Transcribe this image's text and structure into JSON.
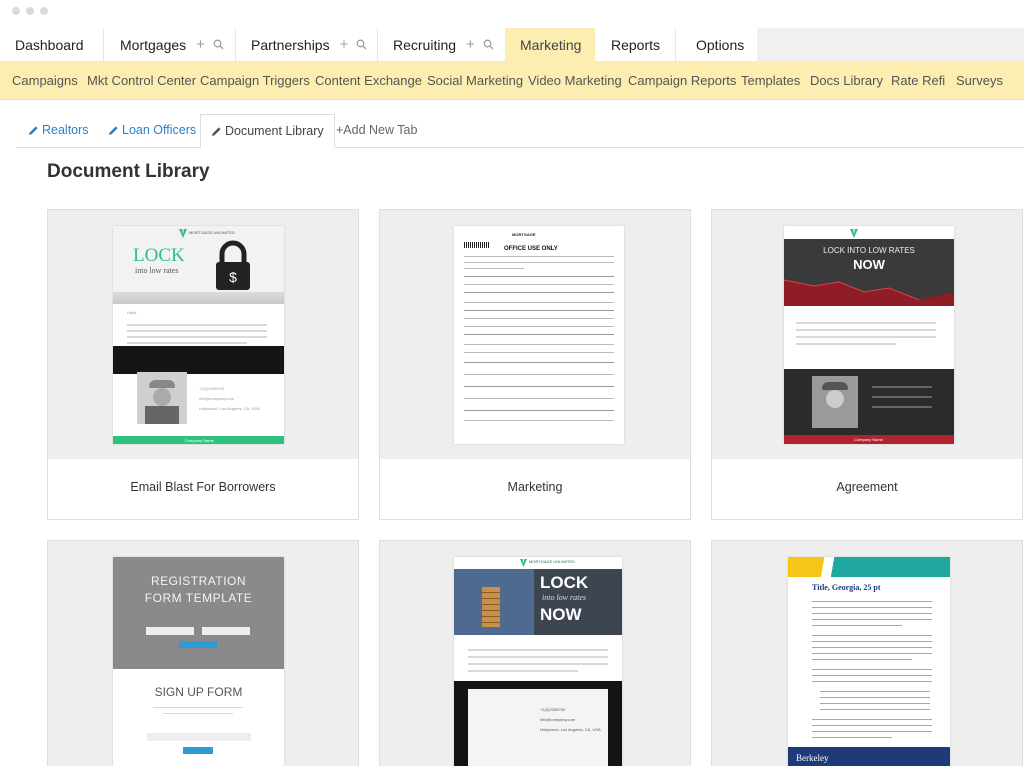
{
  "top_nav": {
    "tabs": [
      {
        "label": "Dashboard",
        "has_actions": false,
        "active": false
      },
      {
        "label": "Mortgages",
        "has_actions": true,
        "active": false
      },
      {
        "label": "Partnerships",
        "has_actions": true,
        "active": false
      },
      {
        "label": "Recruiting",
        "has_actions": true,
        "active": false
      },
      {
        "label": "Marketing",
        "has_actions": false,
        "active": true
      },
      {
        "label": "Reports",
        "has_actions": false,
        "active": false
      },
      {
        "label": "Options",
        "has_actions": false,
        "active": false
      }
    ],
    "action_icons": [
      "plus-icon",
      "search-icon"
    ]
  },
  "sub_nav": {
    "items": [
      "Campaigns",
      "Mkt Control Center",
      "Campaign Triggers",
      "Content Exchange",
      "Social Marketing",
      "Video Marketing",
      "Campaign Reports",
      "Templates",
      "Docs Library",
      "Rate Refi",
      "Surveys"
    ]
  },
  "page_tabs": {
    "items": [
      {
        "label": "Realtors",
        "icon": "pencil-icon",
        "active": false
      },
      {
        "label": "Loan Officers",
        "icon": "pencil-icon",
        "active": false
      },
      {
        "label": "Document Library",
        "icon": "pencil-icon",
        "active": true
      },
      {
        "label": "+Add New Tab",
        "icon": "",
        "active": false
      }
    ]
  },
  "page": {
    "title": "Document Library"
  },
  "cards": [
    {
      "caption": "Email Blast For Borrowers",
      "thumb": {
        "brand": "MORTGAGE UNLIMITED",
        "headline": "LOCK",
        "subhead": "into low rates",
        "greeting": "Hello,",
        "phone": "+1(0)2355700",
        "email": "info@company.com",
        "address": "Hollywood, Los Angeles, CA, USA",
        "footer": "Company Name"
      }
    },
    {
      "caption": "Marketing",
      "thumb": {
        "form_title": "MORTGAGE",
        "office_use": "OFFICE USE ONLY"
      }
    },
    {
      "caption": "Agreement",
      "thumb": {
        "headline_top": "LOCK INTO LOW RATES",
        "headline_main": "NOW",
        "footer": "Company Name"
      }
    },
    {
      "caption": "",
      "thumb": {
        "heading": "REGISTRATION FORM TEMPLATE",
        "subheading": "SIGN UP FORM"
      }
    },
    {
      "caption": "",
      "thumb": {
        "brand": "MORTGAGE UNLIMITED",
        "headline": "LOCK",
        "subhead": "into low rates",
        "cta": "NOW",
        "phone": "+1(0)2355700",
        "email": "info@company.com",
        "address": "Hollywood, Los Angeles, CA, USA"
      }
    },
    {
      "caption": "",
      "thumb": {
        "title": "Title, Georgia, 25 pt",
        "footer_brand": "Berkeley"
      }
    }
  ],
  "colors": {
    "active_tab_bg": "#fbeeb0",
    "subnav_bg": "#fbeeb0",
    "link_blue": "#2f7fc1",
    "brand_green": "#2ec27e",
    "dark_red": "#b1232f"
  }
}
